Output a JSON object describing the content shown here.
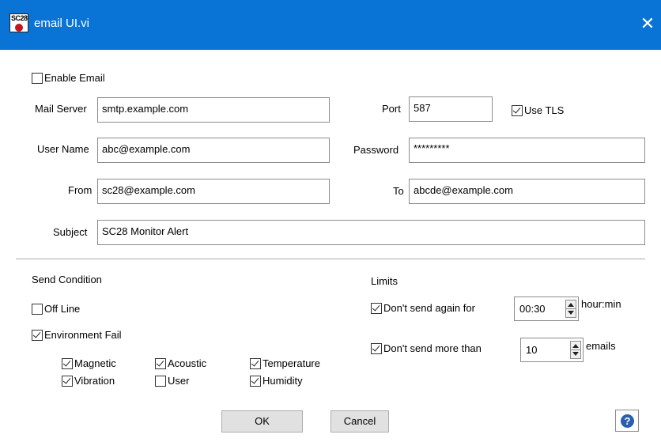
{
  "window": {
    "title": "email UI.vi",
    "icon_text": "SC28",
    "icon": "app-icon",
    "close_icon": "close-icon"
  },
  "enable_email": {
    "label": "Enable Email",
    "checked": false
  },
  "mail_server": {
    "label": "Mail Server",
    "value": "smtp.example.com"
  },
  "port": {
    "label": "Port",
    "value": "587"
  },
  "use_tls": {
    "label": "Use TLS",
    "checked": true
  },
  "user_name": {
    "label": "User Name",
    "value": "abc@example.com"
  },
  "password": {
    "label": "Password",
    "value": "*********"
  },
  "from": {
    "label": "From",
    "value": "sc28@example.com"
  },
  "to": {
    "label": "To",
    "value": "abcde@example.com"
  },
  "subject": {
    "label": "Subject",
    "value": "SC28 Monitor Alert"
  },
  "send_condition": {
    "title": "Send Condition",
    "off_line": {
      "label": "Off Line",
      "checked": false
    },
    "environment_fail": {
      "label": "Environment Fail",
      "checked": true
    },
    "magnetic": {
      "label": "Magnetic",
      "checked": true
    },
    "acoustic": {
      "label": "Acoustic",
      "checked": true
    },
    "temperature": {
      "label": "Temperature",
      "checked": true
    },
    "vibration": {
      "label": "Vibration",
      "checked": true
    },
    "user": {
      "label": "User",
      "checked": false
    },
    "humidity": {
      "label": "Humidity",
      "checked": true
    }
  },
  "limits": {
    "title": "Limits",
    "dont_send_again": {
      "label": "Don't send again for",
      "checked": true,
      "value": "00:30",
      "unit": "hour:min"
    },
    "dont_send_more": {
      "label": "Don't send more than",
      "checked": true,
      "value": "10",
      "unit": "emails"
    }
  },
  "buttons": {
    "ok": "OK",
    "cancel": "Cancel",
    "help_icon": "help-icon"
  },
  "colors": {
    "titlebar": "#0a74d6",
    "accent": "#2a5fb0"
  }
}
